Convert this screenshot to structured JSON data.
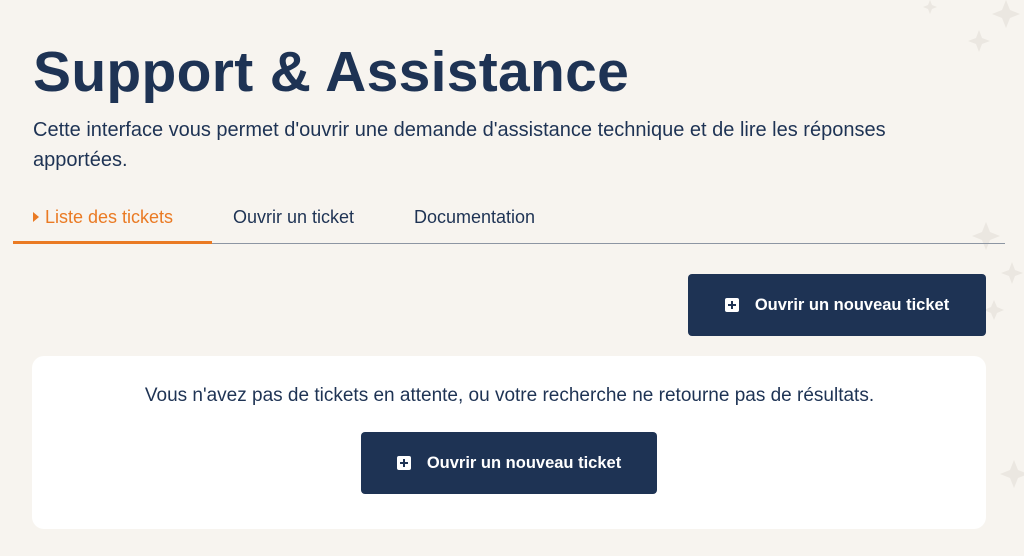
{
  "header": {
    "title": "Support & Assistance",
    "description": "Cette interface vous permet d'ouvrir une demande d'assistance technique et de lire les réponses apportées."
  },
  "tabs": [
    {
      "label": "Liste des tickets",
      "active": true
    },
    {
      "label": "Ouvrir un ticket",
      "active": false
    },
    {
      "label": "Documentation",
      "active": false
    }
  ],
  "toolbar": {
    "new_ticket_label": "Ouvrir un nouveau ticket",
    "icon": "plus-square-icon"
  },
  "empty_state": {
    "message": "Vous n'avez pas de tickets en attente, ou votre recherche ne retourne pas de résultats.",
    "new_ticket_label": "Ouvrir un nouveau ticket",
    "icon": "plus-square-icon"
  },
  "colors": {
    "background": "#f7f4ef",
    "primary": "#1e3354",
    "accent": "#ea7a23",
    "card": "#ffffff"
  }
}
